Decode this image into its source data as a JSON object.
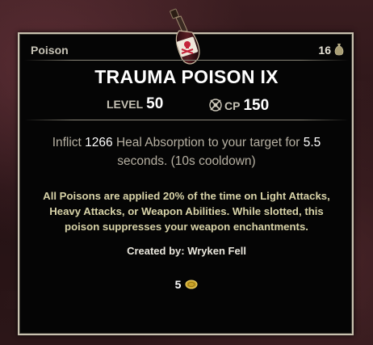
{
  "tooltip": {
    "item_type": "Poison",
    "stack_count": "16",
    "title": "TRAUMA POISON IX",
    "level_label": "LEVEL",
    "level_value": "50",
    "cp_label": "CP",
    "cp_value": "150",
    "description": {
      "part1": "Inflict ",
      "amount": "1266",
      "part2": " Heal Absorption to your target for ",
      "duration": "5.5",
      "part3": " seconds. (10s cooldown)"
    },
    "poison_info": "All Poisons are applied 20% of the time on Light Attacks, Heavy Attacks, or Weapon Abilities. While slotted, this poison suppresses your weapon enchantments.",
    "creator": "Created by: Wryken Fell",
    "value": "5"
  },
  "icons": {
    "item": "poison-bottle-icon",
    "stack": "bag-icon",
    "champion": "champion-points-icon",
    "currency": "gold-coin-icon"
  },
  "colors": {
    "frame": "#c9c2b0",
    "panel": "#050505",
    "title": "#ffffff",
    "body_text": "#b6b0a2",
    "info_text": "#d8d3a8",
    "label_text": "#c5c1b4"
  }
}
